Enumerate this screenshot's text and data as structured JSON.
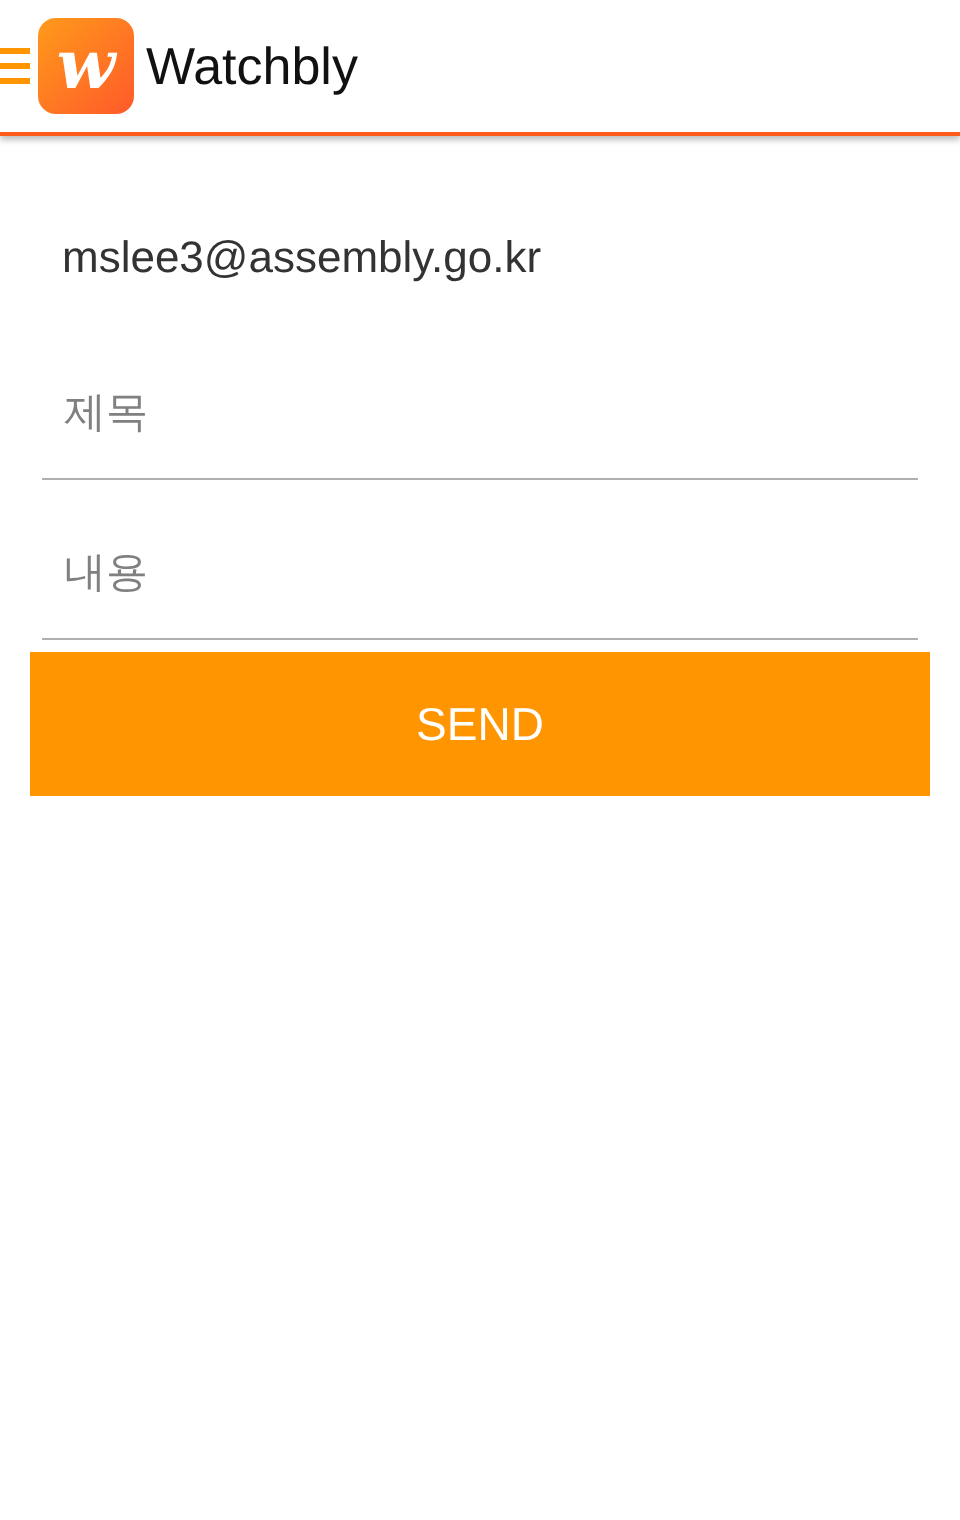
{
  "app_bar": {
    "logo_letter": "w",
    "title": "Watchbly"
  },
  "sender": "mslee3@assembly.go.kr",
  "fields": [
    {
      "placeholder": "제목"
    },
    {
      "placeholder": "내용"
    }
  ],
  "button": "SEND"
}
